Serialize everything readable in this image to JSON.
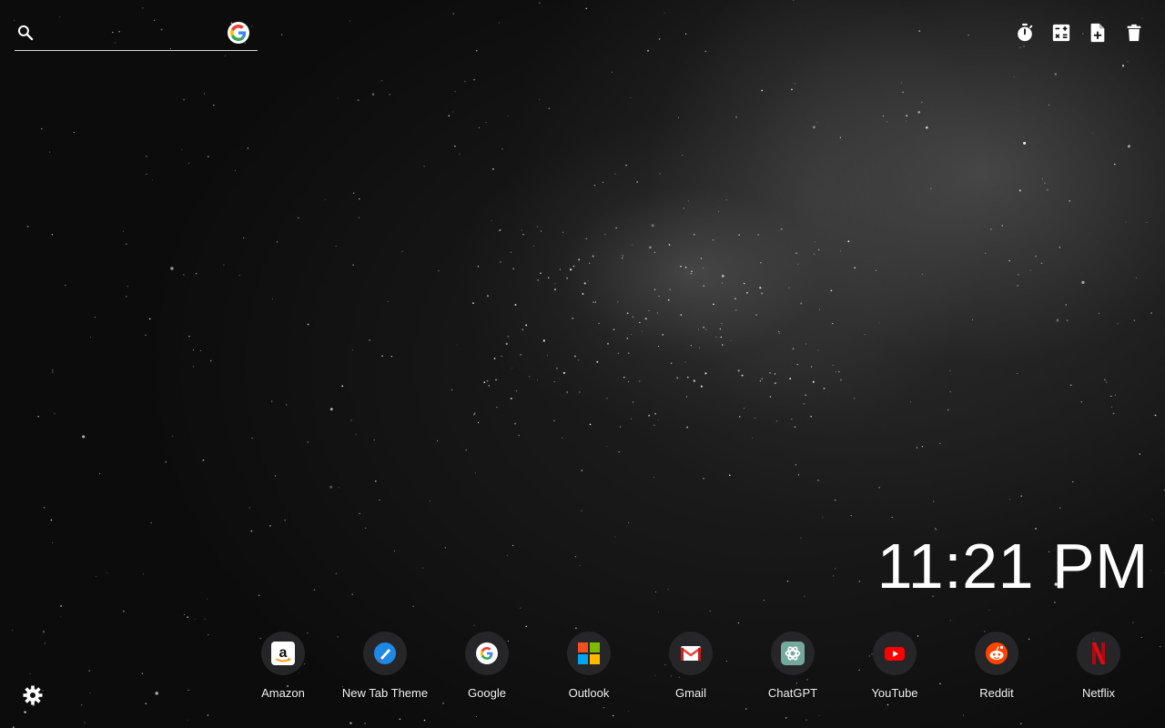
{
  "search": {
    "placeholder": "",
    "engine": "Google",
    "engine_icon": "google-icon"
  },
  "toolbar": {
    "items": [
      {
        "name": "timer",
        "icon": "stopwatch-icon"
      },
      {
        "name": "calculator",
        "icon": "calculator-icon"
      },
      {
        "name": "new-note",
        "icon": "note-add-icon"
      },
      {
        "name": "delete",
        "icon": "trash-icon"
      }
    ]
  },
  "clock": {
    "time": "11:21 PM"
  },
  "shortcuts": [
    {
      "label": "Amazon",
      "icon": "amazon-icon"
    },
    {
      "label": "New Tab Theme",
      "icon": "new-tab-theme-icon"
    },
    {
      "label": "Google",
      "icon": "google-icon"
    },
    {
      "label": "Outlook",
      "icon": "microsoft-icon"
    },
    {
      "label": "Gmail",
      "icon": "gmail-icon"
    },
    {
      "label": "ChatGPT",
      "icon": "chatgpt-icon"
    },
    {
      "label": "YouTube",
      "icon": "youtube-icon"
    },
    {
      "label": "Reddit",
      "icon": "reddit-icon"
    },
    {
      "label": "Netflix",
      "icon": "netflix-icon"
    }
  ],
  "settings": {
    "icon": "gear-icon"
  },
  "colors": {
    "text": "#ffffff",
    "tile": "#28282a",
    "google_blue": "#4285F4",
    "google_red": "#EA4335",
    "google_yellow": "#FBBC05",
    "google_green": "#34A853",
    "amazon_orange": "#FF9900",
    "youtube_red": "#FF0000",
    "reddit_orange": "#FF4500",
    "netflix_red": "#E50914",
    "chatgpt_teal": "#74AA9C"
  }
}
